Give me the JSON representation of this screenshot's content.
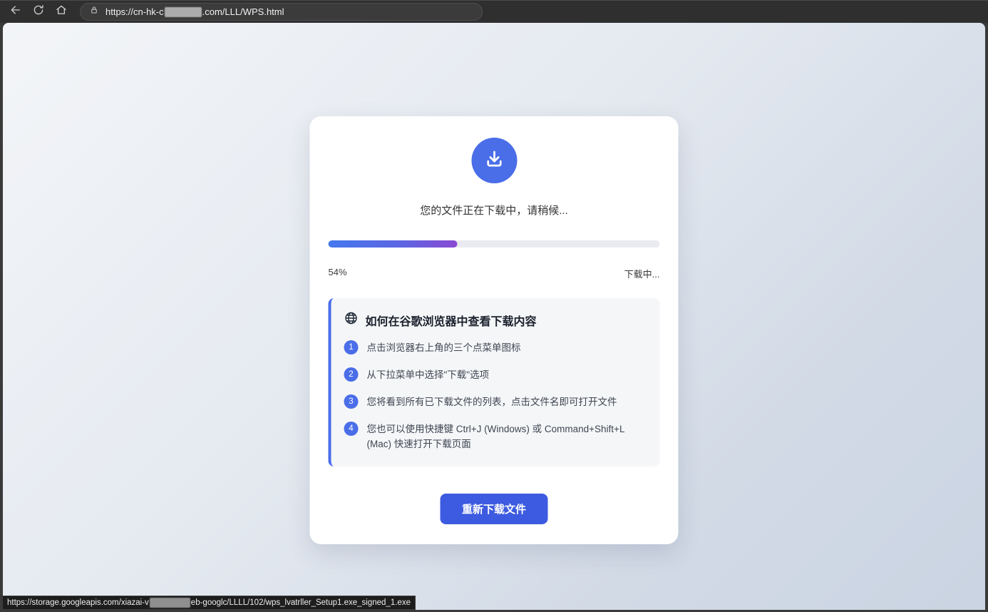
{
  "browser": {
    "url": {
      "prefix": "https://cn-hk-c",
      "suffix": ".com/LLL/WPS.html"
    }
  },
  "card": {
    "status_message": "您的文件正在下载中，请稍候...",
    "progress": {
      "percent_label": "54%",
      "status_label": "下载中...",
      "bar_fill_percent": 39
    },
    "instructions": {
      "title": "如何在谷歌浏览器中查看下载内容",
      "steps": [
        {
          "num": "1",
          "text": "点击浏览器右上角的三个点菜单图标"
        },
        {
          "num": "2",
          "text": "从下拉菜单中选择\"下载\"选项"
        },
        {
          "num": "3",
          "text": "您将看到所有已下载文件的列表，点击文件名即可打开文件"
        },
        {
          "num": "4",
          "text": "您也可以使用快捷键 Ctrl+J (Windows) 或 Command+Shift+L (Mac) 快速打开下载页面"
        }
      ]
    },
    "redownload_button_label": "重新下载文件"
  },
  "statusbar": {
    "link_prefix": "https://storage.googleapis.com/xiazai-v",
    "link_suffix": "eb-googlc/LLLL/102/wps_lvatrller_Setup1.exe_signed_1.exe"
  },
  "colors": {
    "accent_blue": "#4a6de8",
    "button_blue": "#3d5be0",
    "progress_gradient_start": "#4478ee",
    "progress_gradient_end": "#8a49d2",
    "chrome_dark": "#2f2f2f"
  }
}
